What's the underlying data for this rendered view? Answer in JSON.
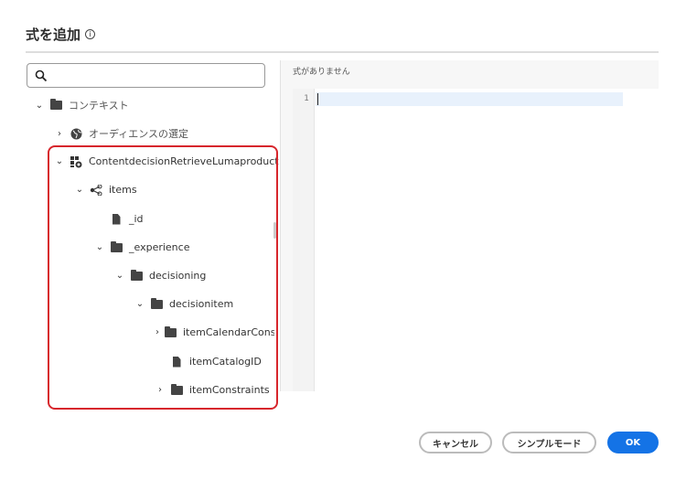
{
  "dialog": {
    "title": "式を追加",
    "info_icon": "i"
  },
  "search": {
    "placeholder": "",
    "value": ""
  },
  "tree": [
    {
      "label": "コンテキスト",
      "icon": "folder-icon",
      "expanded": true
    },
    {
      "label": "オーディエンスの選定",
      "icon": "globe-icon",
      "expanded": false
    },
    {
      "label": "ContentdecisionRetrieveLumaproduct",
      "icon": "decision-icon",
      "expanded": true
    },
    {
      "label": "items",
      "icon": "share-icon",
      "expanded": true
    },
    {
      "label": "_id",
      "icon": "file-icon"
    },
    {
      "label": "_experience",
      "icon": "folder-icon",
      "expanded": true
    },
    {
      "label": "decisioning",
      "icon": "folder-icon",
      "expanded": true
    },
    {
      "label": "decisionitem",
      "icon": "folder-icon",
      "expanded": true
    },
    {
      "label": "itemCalendarConstr",
      "icon": "folder-icon",
      "expanded": false
    },
    {
      "label": "itemCatalogID",
      "icon": "file-icon"
    },
    {
      "label": "itemConstraints",
      "icon": "folder-icon",
      "expanded": false
    }
  ],
  "editor": {
    "empty_label": "式がありません",
    "line_number": "1"
  },
  "footer": {
    "cancel": "キャンセル",
    "simple_mode": "シンプルモード",
    "ok": "OK"
  },
  "colors": {
    "accent": "#1473e6",
    "highlight": "#d7262c"
  }
}
